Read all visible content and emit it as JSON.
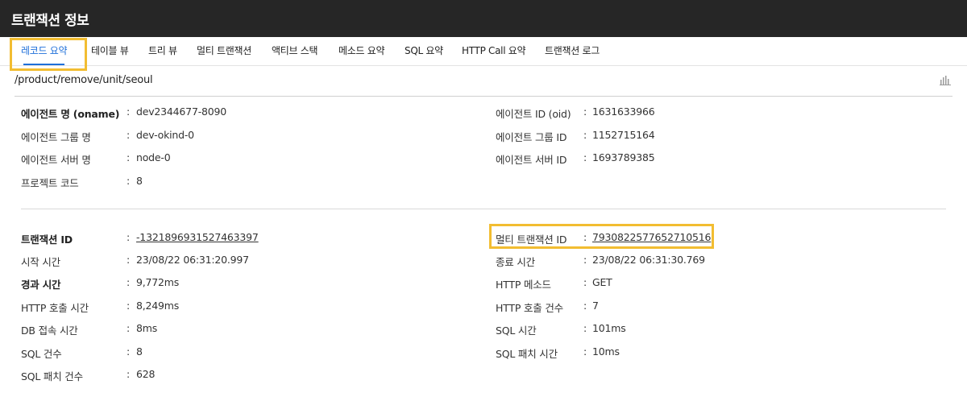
{
  "window": {
    "title": "트랜잭션 정보"
  },
  "tabs": [
    {
      "label": "레코드 요약",
      "active": true
    },
    {
      "label": "테이블 뷰"
    },
    {
      "label": "트리 뷰"
    },
    {
      "label": "멀티 트랜잭션"
    },
    {
      "label": "액티브 스택"
    },
    {
      "label": "메소드 요약"
    },
    {
      "label": "SQL 요약"
    },
    {
      "label": "HTTP Call 요약"
    },
    {
      "label": "트랜잭션 로그"
    }
  ],
  "path": "/product/remove/unit/seoul",
  "colon": ":",
  "agent": {
    "left": [
      {
        "label": "에이전트 명 (oname)",
        "value": "dev2344677-8090"
      },
      {
        "label": "에이전트 그룹 명",
        "value": "dev-okind-0"
      },
      {
        "label": "에이전트 서버 명",
        "value": "node-0"
      },
      {
        "label": "프로젝트 코드",
        "value": "8"
      }
    ],
    "right": [
      {
        "label": "에이전트 ID (oid)",
        "value": "1631633966"
      },
      {
        "label": "에이전트 그룹 ID",
        "value": "1152715164"
      },
      {
        "label": "에이전트 서버 ID",
        "value": "1693789385"
      }
    ]
  },
  "transaction": {
    "left": [
      {
        "label": "트랜잭션 ID",
        "value": "-1321896931527463397"
      },
      {
        "label": "시작 시간",
        "value": "23/08/22 06:31:20.997"
      },
      {
        "label": "경과 시간",
        "value": "9,772ms"
      },
      {
        "label": "HTTP 호출 시간",
        "value": "8,249ms"
      },
      {
        "label": "DB 접속 시간",
        "value": "8ms"
      },
      {
        "label": "SQL 건수",
        "value": "8"
      },
      {
        "label": "SQL 패치 건수",
        "value": "628"
      }
    ],
    "right": [
      {
        "label": "멀티 트랜잭션 ID",
        "value": "7930822577652710516"
      },
      {
        "label": "종료 시간",
        "value": "23/08/22 06:31:30.769"
      },
      {
        "label": "HTTP 메소드",
        "value": "GET"
      },
      {
        "label": "HTTP 호출 건수",
        "value": "7"
      },
      {
        "label": "SQL 시간",
        "value": "101ms"
      },
      {
        "label": "SQL 패치 시간",
        "value": "10ms"
      }
    ]
  },
  "colors": {
    "accent": "#1e6fd9",
    "highlight": "#f2bd31",
    "titlebar": "#262626"
  },
  "icons": {
    "chart": "bar-chart-icon"
  }
}
